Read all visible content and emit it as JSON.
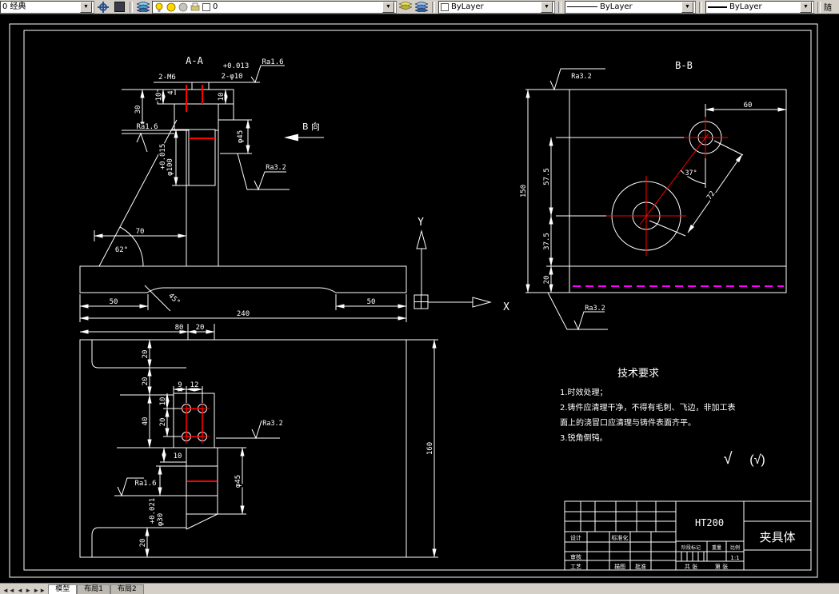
{
  "toolbar": {
    "workspace": "0 经典",
    "layer_name": "0",
    "color_value": "ByLayer",
    "linetype_value": "ByLayer",
    "lineweight_value": "ByLayer",
    "right_partial": "随"
  },
  "tabs": {
    "model": "模型",
    "layout1": "布局1",
    "layout2": "布局2"
  },
  "views": {
    "front": {
      "title": "A-A",
      "holes_label_left": "2-M6",
      "holes_label_right": "2-φ10",
      "tol_top": "+0.013",
      "ra_top": "Ra1.6",
      "ra_left": "Ra1.6",
      "ra_right": "Ra3.2",
      "b_dir": "B 向",
      "dim_30": "30",
      "dim_10_left": "10",
      "dim_4": "4",
      "dim_10_right": "10",
      "tol_phi100": "+0.015",
      "dim_phi100": "φ100",
      "dim_phi45": "φ45",
      "dim_70": "70",
      "angle_62": "62°",
      "angle_45": "45°",
      "dim_50_left": "50",
      "dim_50_right": "50",
      "dim_240": "240",
      "dim_80": "80",
      "dim_20": "20"
    },
    "plan": {
      "dim_20_step1": "20",
      "dim_20_step2": "20",
      "dim_40": "40",
      "dim_9": "9",
      "dim_12": "12",
      "dim_10_holes": "10",
      "dim_20_holes": "20",
      "dim_10_section": "10",
      "ra_bore": "Ra1.6",
      "ra_boss": "Ra3.2",
      "tol_phi30": "+0.021",
      "dim_phi30": "φ30",
      "dim_phi45": "φ45",
      "dim_20_bottom": "20",
      "dim_160": "160"
    },
    "side": {
      "title": "B-B",
      "ra_top": "Ra3.2",
      "ra_bottom": "Ra3.2",
      "dim_60": "60",
      "dim_57_5": "57.5",
      "dim_37_5": "37.5",
      "dim_20": "20",
      "dim_150": "150",
      "angle_37": "37°",
      "dim_72": "72"
    }
  },
  "ucs": {
    "x_label": "X",
    "y_label": "Y"
  },
  "tech_requirements": {
    "title": "技术要求",
    "lines": [
      "1.时效处理；",
      "2.铸件应清理干净，不得有毛刺、飞边，非加工表",
      "面上的浇冒口应清理与铸件表面齐平。",
      "3.锐角倒钝。"
    ]
  },
  "surface_note": {
    "primary": "√",
    "other": "(√)"
  },
  "title_block": {
    "material": "HT200",
    "part_name": "夹具体",
    "design_label": "设计",
    "standard_label": "标准化",
    "check_label": "审核",
    "process_label": "工艺",
    "trace_label": "描图",
    "approve_label": "批准",
    "stage_label": "阶段标记",
    "weight_label": "重量",
    "scale_label": "比例",
    "scale_value": "1:1",
    "sheet_total_label": "共 张",
    "sheet_no_label": "第 张"
  },
  "colors": {
    "accent_red": "#ff0000",
    "magenta": "#ff00ff",
    "line": "#ffffff",
    "toolbar_bg": "#d4d0c8"
  }
}
